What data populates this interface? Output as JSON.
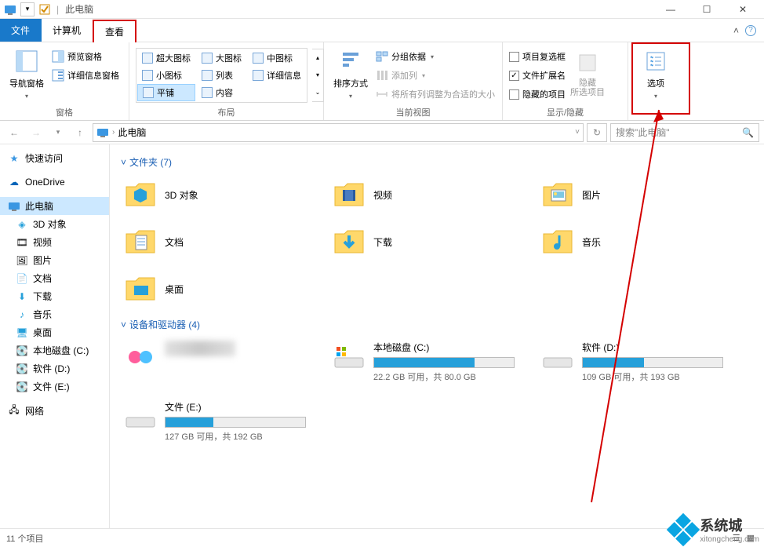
{
  "titlebar": {
    "title": "此电脑"
  },
  "win": {
    "min": "—",
    "max": "☐",
    "close": "✕"
  },
  "tabs": {
    "file": "文件",
    "computer": "计算机",
    "view": "查看"
  },
  "ribbon": {
    "panes": {
      "label": "窗格",
      "nav": "导航窗格",
      "preview": "预览窗格",
      "details": "详细信息窗格"
    },
    "layout": {
      "label": "布局",
      "items": [
        "超大图标",
        "大图标",
        "中图标",
        "小图标",
        "列表",
        "详细信息",
        "平铺",
        "内容"
      ]
    },
    "currentview": {
      "label": "当前视图",
      "sort": "排序方式",
      "group": "分组依据",
      "addcol": "添加列",
      "autofit": "将所有列调整为合适的大小"
    },
    "showhide": {
      "label": "显示/隐藏",
      "checkboxes": "项目复选框",
      "extensions": "文件扩展名",
      "hidden": "隐藏的项目",
      "hideselected": "隐藏\n所选项目"
    },
    "options": "选项"
  },
  "addr": {
    "location": "此电脑"
  },
  "search": {
    "placeholder": "搜索\"此电脑\""
  },
  "sidebar": {
    "quick": "快速访问",
    "onedrive": "OneDrive",
    "thispc": "此电脑",
    "items": [
      "3D 对象",
      "视频",
      "图片",
      "文档",
      "下载",
      "音乐",
      "桌面",
      "本地磁盘 (C:)",
      "软件 (D:)",
      "文件 (E:)"
    ],
    "network": "网络"
  },
  "groups": {
    "folders": {
      "title": "文件夹 (7)",
      "items": [
        "3D 对象",
        "视频",
        "图片",
        "文档",
        "下载",
        "音乐",
        "桌面"
      ]
    },
    "drives": {
      "title": "设备和驱动器 (4)",
      "list": [
        {
          "name": "",
          "stat": "",
          "fill": 0,
          "hidden": true
        },
        {
          "name": "本地磁盘 (C:)",
          "stat": "22.2 GB 可用，共 80.0 GB",
          "fill": 72
        },
        {
          "name": "软件 (D:)",
          "stat": "109 GB 可用，共 193 GB",
          "fill": 44
        },
        {
          "name": "文件 (E:)",
          "stat": "127 GB 可用，共 192 GB",
          "fill": 34
        }
      ]
    }
  },
  "status": {
    "text": "11 个项目"
  },
  "watermark": {
    "brand": "系统城",
    "url": "xitongcheng.com"
  }
}
